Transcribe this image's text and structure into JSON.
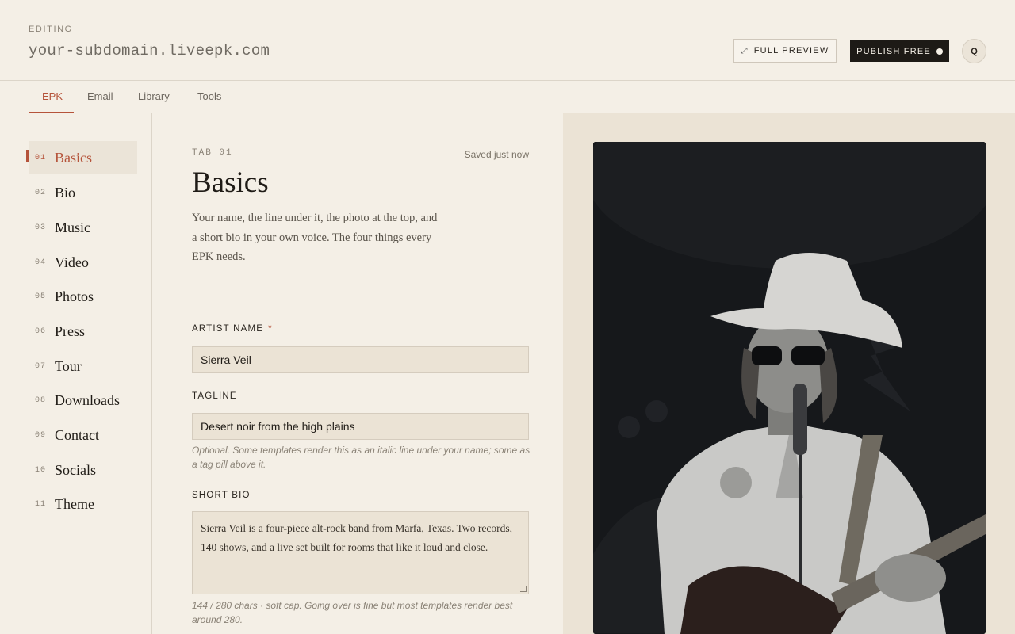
{
  "header": {
    "editing_label": "EDITING",
    "domain": "your-subdomain.liveepk.com",
    "preview_label": "FULL PREVIEW",
    "publish_label": "PUBLISH FREE",
    "avatar_initial": "Q"
  },
  "tabs": [
    {
      "label": "EPK",
      "active": true
    },
    {
      "label": "Email",
      "active": false
    },
    {
      "label": "Library",
      "active": false
    },
    {
      "label": "Tools",
      "active": false
    }
  ],
  "sidebar": {
    "items": [
      {
        "num": "01",
        "label": "Basics",
        "active": true
      },
      {
        "num": "02",
        "label": "Bio"
      },
      {
        "num": "03",
        "label": "Music"
      },
      {
        "num": "04",
        "label": "Video"
      },
      {
        "num": "05",
        "label": "Photos"
      },
      {
        "num": "06",
        "label": "Press"
      },
      {
        "num": "07",
        "label": "Tour"
      },
      {
        "num": "08",
        "label": "Downloads"
      },
      {
        "num": "09",
        "label": "Contact"
      },
      {
        "num": "10",
        "label": "Socials"
      },
      {
        "num": "11",
        "label": "Theme"
      }
    ]
  },
  "form": {
    "tab_code": "TAB 01",
    "saved_status": "Saved just now",
    "title": "Basics",
    "intro": "Your name, the line under it, the photo at the top, and a short bio in your own voice. The four things every EPK needs.",
    "artist_name_label": "ARTIST NAME",
    "required_mark": "*",
    "artist_name_value": "Sierra Veil",
    "tagline_label": "TAGLINE",
    "tagline_value": "Desert noir from the high plains",
    "tagline_help": "Optional. Some templates render this as an italic line under your name; some as a tag pill above it.",
    "bio_label": "SHORT BIO",
    "bio_value": "Sierra Veil is a four-piece alt-rock band from Marfa, Texas. Two records, 140 shows, and a live set built for rooms that like it loud and close.",
    "bio_help": "144 / 280 chars · soft cap. Going over is fine but most templates render best around 280."
  },
  "colors": {
    "accent": "#b5533a",
    "background": "#f4efe6",
    "input_bg": "#ebe3d5",
    "dark": "#1d1a16"
  }
}
